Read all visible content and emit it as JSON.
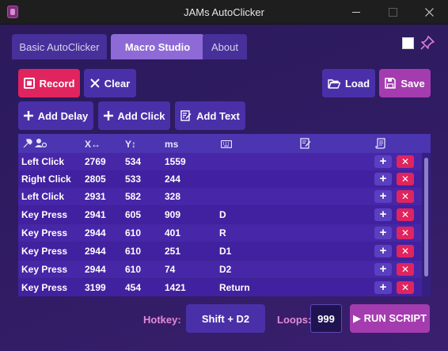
{
  "window": {
    "title": "JAMs AutoClicker"
  },
  "tabs": [
    {
      "label": "Basic AutoClicker"
    },
    {
      "label": "Macro Studio"
    },
    {
      "label": "About"
    }
  ],
  "toolbar": {
    "record": "Record",
    "clear": "Clear",
    "load": "Load",
    "save": "Save",
    "add_delay": "Add Delay",
    "add_click": "Add Click",
    "add_text": "Add Text"
  },
  "table": {
    "headers": {
      "x": "X↔",
      "y": "Y↕",
      "ms": "ms"
    },
    "rows": [
      {
        "action": "Left Click",
        "x": "2769",
        "y": "534",
        "ms": "1559",
        "key": "",
        "text": ""
      },
      {
        "action": "Right Click",
        "x": "2805",
        "y": "533",
        "ms": "244",
        "key": "",
        "text": ""
      },
      {
        "action": "Left Click",
        "x": "2931",
        "y": "582",
        "ms": "328",
        "key": "",
        "text": ""
      },
      {
        "action": "Key Press",
        "x": "2941",
        "y": "605",
        "ms": "909",
        "key": "D",
        "text": ""
      },
      {
        "action": "Key Press",
        "x": "2944",
        "y": "610",
        "ms": "401",
        "key": "R",
        "text": ""
      },
      {
        "action": "Key Press",
        "x": "2944",
        "y": "610",
        "ms": "251",
        "key": "D1",
        "text": ""
      },
      {
        "action": "Key Press",
        "x": "2944",
        "y": "610",
        "ms": "74",
        "key": "D2",
        "text": ""
      },
      {
        "action": "Key Press",
        "x": "3199",
        "y": "454",
        "ms": "1421",
        "key": "Return",
        "text": ""
      }
    ]
  },
  "footer": {
    "hotkey_label": "Hotkey:",
    "hotkey_value": "Shift + D2",
    "loops_label": "Loops:",
    "loops_value": "999",
    "run_label": "▶ RUN SCRIPT"
  },
  "colors": {
    "accent_pink": "#e0245e",
    "accent_magenta": "#a43cb0",
    "button_purple": "#4a30a8",
    "label_pink": "#e48ad8"
  }
}
